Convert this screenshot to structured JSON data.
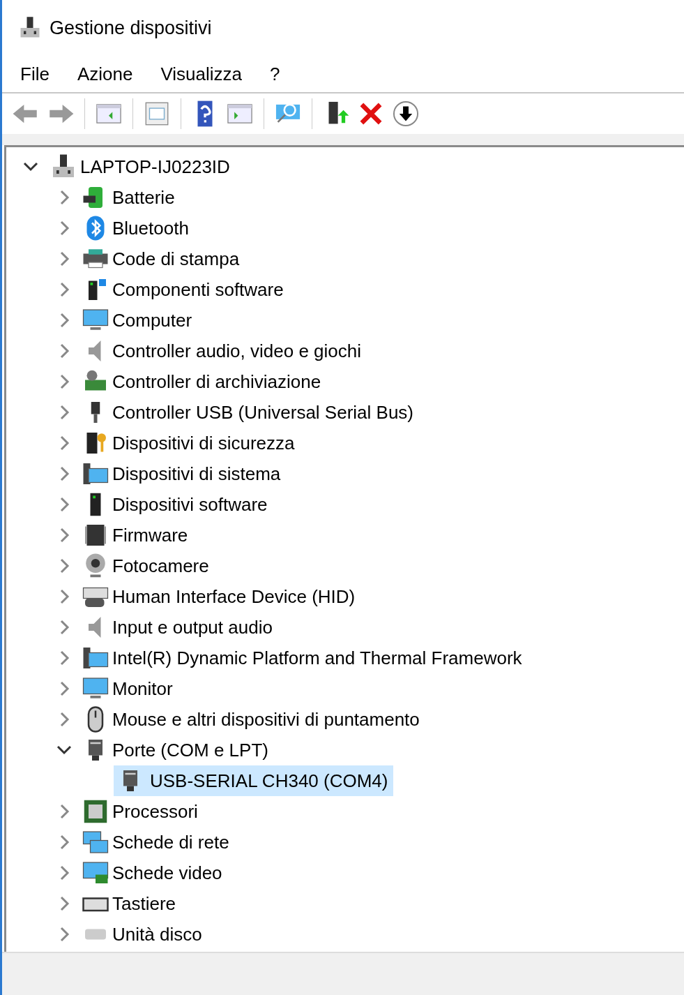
{
  "window": {
    "title": "Gestione dispositivi"
  },
  "menu": [
    "File",
    "Azione",
    "Visualizza",
    "?"
  ],
  "tree": {
    "label": "LAPTOP-IJ0223ID",
    "expanded": true,
    "children": [
      {
        "label": "Batterie",
        "expanded": false
      },
      {
        "label": "Bluetooth",
        "expanded": false
      },
      {
        "label": "Code di stampa",
        "expanded": false
      },
      {
        "label": "Componenti software",
        "expanded": false
      },
      {
        "label": "Computer",
        "expanded": false
      },
      {
        "label": "Controller audio, video e giochi",
        "expanded": false
      },
      {
        "label": "Controller di archiviazione",
        "expanded": false
      },
      {
        "label": "Controller USB (Universal Serial Bus)",
        "expanded": false
      },
      {
        "label": "Dispositivi di sicurezza",
        "expanded": false
      },
      {
        "label": "Dispositivi di sistema",
        "expanded": false
      },
      {
        "label": "Dispositivi software",
        "expanded": false
      },
      {
        "label": "Firmware",
        "expanded": false
      },
      {
        "label": "Fotocamere",
        "expanded": false
      },
      {
        "label": "Human Interface Device (HID)",
        "expanded": false
      },
      {
        "label": "Input e output audio",
        "expanded": false
      },
      {
        "label": "Intel(R) Dynamic Platform and Thermal Framework",
        "expanded": false
      },
      {
        "label": "Monitor",
        "expanded": false
      },
      {
        "label": "Mouse e altri dispositivi di puntamento",
        "expanded": false
      },
      {
        "label": "Porte (COM e LPT)",
        "expanded": true,
        "children": [
          {
            "label": "USB-SERIAL CH340 (COM4)",
            "selected": true
          }
        ]
      },
      {
        "label": "Processori",
        "expanded": false
      },
      {
        "label": "Schede di rete",
        "expanded": false
      },
      {
        "label": "Schede video",
        "expanded": false
      },
      {
        "label": "Tastiere",
        "expanded": false
      },
      {
        "label": "Unità disco",
        "expanded": false
      }
    ]
  }
}
